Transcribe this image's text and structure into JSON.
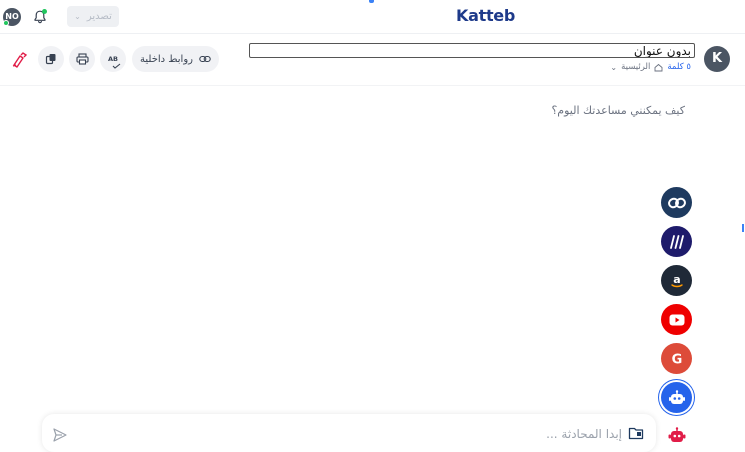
{
  "topbar": {
    "user_initials": "NO",
    "export_label": "تصدير",
    "logo_text": "Katteb"
  },
  "toolbar": {
    "internal_links_label": "روابط داخلية",
    "spellcheck_label": "AB"
  },
  "document": {
    "title_value": "بدون عنوان",
    "word_count": "٥ كلمة",
    "breadcrumb_home": "الرئيسية"
  },
  "author": {
    "initial": "K"
  },
  "chat": {
    "prompt_text": "كيف يمكنني مساعدتك اليوم؟",
    "input_placeholder": "إبدا المحادثة ..."
  },
  "side_tools": [
    {
      "icon": "link-icon",
      "color": "#1e3a5f"
    },
    {
      "icon": "perplexity-icon",
      "color": "#1e1b6b"
    },
    {
      "icon": "amazon-icon",
      "color": "#1f2937"
    },
    {
      "icon": "youtube-icon",
      "color": "#ef0000"
    },
    {
      "icon": "google-icon",
      "color": "#dd4b39"
    },
    {
      "icon": "bot-icon",
      "color": "#2563eb"
    }
  ],
  "colors": {
    "accent": "#2563eb",
    "brand": "#1e3a8a",
    "red_tool": "#e11d48"
  }
}
